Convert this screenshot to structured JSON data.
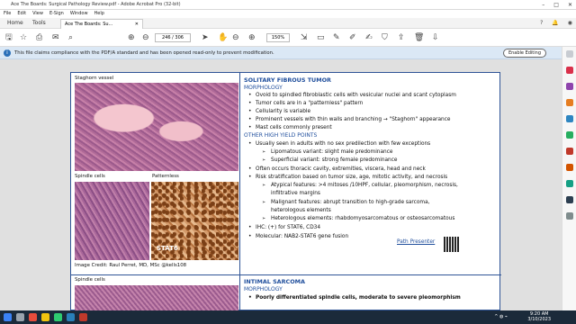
{
  "window": {
    "title": "Ace The Boards: Surgical Pathology Review.pdf - Adobe Acrobat Pro (32-bit)"
  },
  "menu": [
    "File",
    "Edit",
    "View",
    "E-Sign",
    "Window",
    "Help"
  ],
  "tabs": {
    "home": "Home",
    "tools": "Tools",
    "doc": "Ace The Boards: Su..."
  },
  "toolbar": {
    "page_current": "246",
    "page_total": "/ 306",
    "zoom": "150%"
  },
  "notice": {
    "message": "This file claims compliance with the PDF/A standard and has been opened read-only to prevent modification.",
    "edit_button": "Enable Editing"
  },
  "page": {
    "captions": {
      "staghorn": "Staghorn vessel",
      "spindle": "Spindle cells",
      "patternless": "Patternless",
      "stat6": "STAT6",
      "credit": "Image Credit: Raul Perret, MD, MSc @kells108",
      "spindle2": "Spindle cells"
    },
    "sft": {
      "title": "SOLITARY FIBROUS TUMOR",
      "morph_head": "MORPHOLOGY",
      "m1": "Ovoid to spindled fibroblastic cells with vesicular nuclei and scant cytoplasm",
      "m2": "Tumor cells are in a \"patternless\" pattern",
      "m3": "Cellularity is variable",
      "m4": "Prominent vessels with thin walls and branching → \"Staghorn\" appearance",
      "m5": "Mast cells commonly present",
      "hy_head": "OTHER HIGH YIELD POINTS",
      "h1": "Usually seen in adults with no sex predilection with few exceptions",
      "h1a": "Lipomatous variant: slight male predominance",
      "h1b": "Superficial variant: strong female predominance",
      "h2": "Often occurs thoracic cavity, extremities, viscera, head and neck",
      "h3": "Risk stratification based on tumor size, age, mitotic activity, and necrosis",
      "h3a": "Atypical features: >4 mitoses /10HPF, cellular, pleomorphism, necrosis,",
      "h3a2": "infiltrative margins",
      "h3b": "Malignant features: abrupt transition to high-grade sarcoma,",
      "h3b2": "heterologous elements",
      "h3c": "Heterologous elements: rhabdomyosarcomatous or osteosarcomatous",
      "h4": "IHC: (+) for STAT6, CD34",
      "h5": "Molecular: NAB2-STAT6 gene fusion",
      "path_presenter": "Path Presenter"
    },
    "intimal": {
      "title": "INTIMAL SARCOMA",
      "morph_head": "MORPHOLOGY",
      "m1": "Poorly differentiated spindle cells, moderate to severe pleomorphism"
    }
  },
  "status": {
    "time": "9:20 AM",
    "date": "3/10/2023"
  },
  "colors": {
    "accent": "#1f4e9c",
    "taskbar": "#1b2a3a",
    "notice": "#dbe8f5"
  }
}
